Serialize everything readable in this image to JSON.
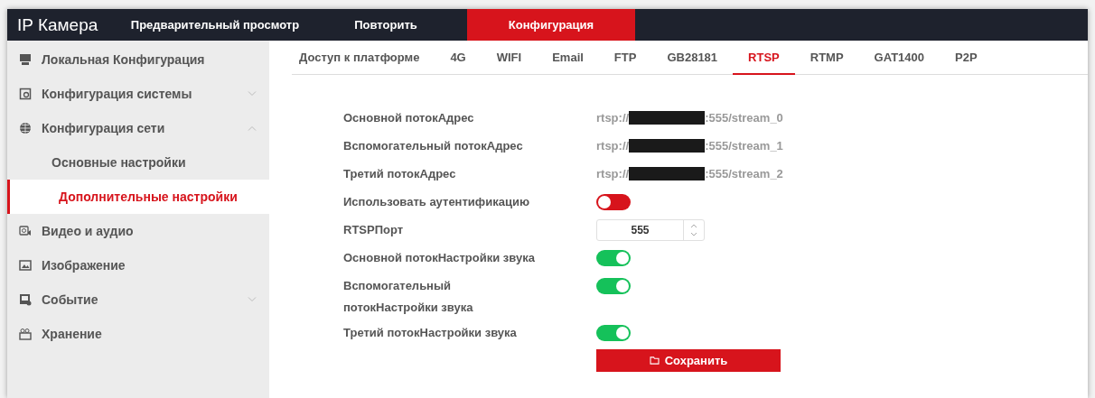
{
  "header": {
    "logo": "IP Камера",
    "nav": [
      {
        "label": "Предварительный просмотр",
        "selected": false
      },
      {
        "label": "Повторить",
        "selected": false
      },
      {
        "label": "Конфигурация",
        "selected": true
      }
    ]
  },
  "sidebar": {
    "items": [
      {
        "label": "Локальная Конфигурация",
        "selected": false
      },
      {
        "label": "Конфигурация системы",
        "selected": false,
        "expanded": false
      },
      {
        "label": "Конфигурация сети",
        "selected": false,
        "expanded": true,
        "children": [
          {
            "label": "Основные настройки",
            "selected": false
          },
          {
            "label": "Дополнительные настройки",
            "selected": true
          }
        ]
      },
      {
        "label": "Видео и аудио",
        "selected": false
      },
      {
        "label": "Изображение",
        "selected": false
      },
      {
        "label": "Событие",
        "selected": false,
        "expanded": false
      },
      {
        "label": "Хранение",
        "selected": false
      }
    ]
  },
  "tabs": [
    {
      "label": "Доступ к платформе",
      "selected": false
    },
    {
      "label": "4G",
      "selected": false
    },
    {
      "label": "WIFI",
      "selected": false
    },
    {
      "label": "Email",
      "selected": false
    },
    {
      "label": "FTP",
      "selected": false
    },
    {
      "label": "GB28181",
      "selected": false
    },
    {
      "label": "RTSP",
      "selected": true
    },
    {
      "label": "RTMP",
      "selected": false
    },
    {
      "label": "GAT1400",
      "selected": false
    },
    {
      "label": "P2P",
      "selected": false
    }
  ],
  "form": {
    "rows": [
      {
        "kind": "address",
        "label": "Основной потокАдрес",
        "prefix": "rtsp://",
        "suffix": ":555/stream_0"
      },
      {
        "kind": "address",
        "label": "Вспомогательный потокАдрес",
        "prefix": "rtsp://",
        "suffix": ":555/stream_1"
      },
      {
        "kind": "address",
        "label": "Третий потокАдрес",
        "prefix": "rtsp://",
        "suffix": ":555/stream_2"
      },
      {
        "kind": "toggle",
        "label": "Использовать аутентификацию",
        "on": false
      },
      {
        "kind": "number",
        "label": "RTSPПорт",
        "value": "555"
      },
      {
        "kind": "toggle",
        "label": "Основной потокНастройки звука",
        "on": true
      },
      {
        "kind": "toggle",
        "label": "Вспомогательный потокНастройки звука",
        "on": true
      },
      {
        "kind": "toggle",
        "label": "Третий потокНастройки звука",
        "on": true
      }
    ],
    "save_button": "Сохранить"
  }
}
